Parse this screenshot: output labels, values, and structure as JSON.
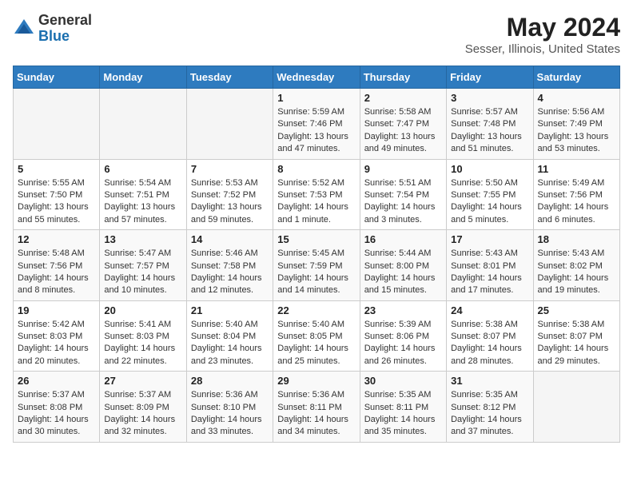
{
  "header": {
    "logo_general": "General",
    "logo_blue": "Blue",
    "title": "May 2024",
    "subtitle": "Sesser, Illinois, United States"
  },
  "calendar": {
    "days_of_week": [
      "Sunday",
      "Monday",
      "Tuesday",
      "Wednesday",
      "Thursday",
      "Friday",
      "Saturday"
    ],
    "weeks": [
      [
        {
          "day": "",
          "info": ""
        },
        {
          "day": "",
          "info": ""
        },
        {
          "day": "",
          "info": ""
        },
        {
          "day": "1",
          "info": "Sunrise: 5:59 AM\nSunset: 7:46 PM\nDaylight: 13 hours\nand 47 minutes."
        },
        {
          "day": "2",
          "info": "Sunrise: 5:58 AM\nSunset: 7:47 PM\nDaylight: 13 hours\nand 49 minutes."
        },
        {
          "day": "3",
          "info": "Sunrise: 5:57 AM\nSunset: 7:48 PM\nDaylight: 13 hours\nand 51 minutes."
        },
        {
          "day": "4",
          "info": "Sunrise: 5:56 AM\nSunset: 7:49 PM\nDaylight: 13 hours\nand 53 minutes."
        }
      ],
      [
        {
          "day": "5",
          "info": "Sunrise: 5:55 AM\nSunset: 7:50 PM\nDaylight: 13 hours\nand 55 minutes."
        },
        {
          "day": "6",
          "info": "Sunrise: 5:54 AM\nSunset: 7:51 PM\nDaylight: 13 hours\nand 57 minutes."
        },
        {
          "day": "7",
          "info": "Sunrise: 5:53 AM\nSunset: 7:52 PM\nDaylight: 13 hours\nand 59 minutes."
        },
        {
          "day": "8",
          "info": "Sunrise: 5:52 AM\nSunset: 7:53 PM\nDaylight: 14 hours\nand 1 minute."
        },
        {
          "day": "9",
          "info": "Sunrise: 5:51 AM\nSunset: 7:54 PM\nDaylight: 14 hours\nand 3 minutes."
        },
        {
          "day": "10",
          "info": "Sunrise: 5:50 AM\nSunset: 7:55 PM\nDaylight: 14 hours\nand 5 minutes."
        },
        {
          "day": "11",
          "info": "Sunrise: 5:49 AM\nSunset: 7:56 PM\nDaylight: 14 hours\nand 6 minutes."
        }
      ],
      [
        {
          "day": "12",
          "info": "Sunrise: 5:48 AM\nSunset: 7:56 PM\nDaylight: 14 hours\nand 8 minutes."
        },
        {
          "day": "13",
          "info": "Sunrise: 5:47 AM\nSunset: 7:57 PM\nDaylight: 14 hours\nand 10 minutes."
        },
        {
          "day": "14",
          "info": "Sunrise: 5:46 AM\nSunset: 7:58 PM\nDaylight: 14 hours\nand 12 minutes."
        },
        {
          "day": "15",
          "info": "Sunrise: 5:45 AM\nSunset: 7:59 PM\nDaylight: 14 hours\nand 14 minutes."
        },
        {
          "day": "16",
          "info": "Sunrise: 5:44 AM\nSunset: 8:00 PM\nDaylight: 14 hours\nand 15 minutes."
        },
        {
          "day": "17",
          "info": "Sunrise: 5:43 AM\nSunset: 8:01 PM\nDaylight: 14 hours\nand 17 minutes."
        },
        {
          "day": "18",
          "info": "Sunrise: 5:43 AM\nSunset: 8:02 PM\nDaylight: 14 hours\nand 19 minutes."
        }
      ],
      [
        {
          "day": "19",
          "info": "Sunrise: 5:42 AM\nSunset: 8:03 PM\nDaylight: 14 hours\nand 20 minutes."
        },
        {
          "day": "20",
          "info": "Sunrise: 5:41 AM\nSunset: 8:03 PM\nDaylight: 14 hours\nand 22 minutes."
        },
        {
          "day": "21",
          "info": "Sunrise: 5:40 AM\nSunset: 8:04 PM\nDaylight: 14 hours\nand 23 minutes."
        },
        {
          "day": "22",
          "info": "Sunrise: 5:40 AM\nSunset: 8:05 PM\nDaylight: 14 hours\nand 25 minutes."
        },
        {
          "day": "23",
          "info": "Sunrise: 5:39 AM\nSunset: 8:06 PM\nDaylight: 14 hours\nand 26 minutes."
        },
        {
          "day": "24",
          "info": "Sunrise: 5:38 AM\nSunset: 8:07 PM\nDaylight: 14 hours\nand 28 minutes."
        },
        {
          "day": "25",
          "info": "Sunrise: 5:38 AM\nSunset: 8:07 PM\nDaylight: 14 hours\nand 29 minutes."
        }
      ],
      [
        {
          "day": "26",
          "info": "Sunrise: 5:37 AM\nSunset: 8:08 PM\nDaylight: 14 hours\nand 30 minutes."
        },
        {
          "day": "27",
          "info": "Sunrise: 5:37 AM\nSunset: 8:09 PM\nDaylight: 14 hours\nand 32 minutes."
        },
        {
          "day": "28",
          "info": "Sunrise: 5:36 AM\nSunset: 8:10 PM\nDaylight: 14 hours\nand 33 minutes."
        },
        {
          "day": "29",
          "info": "Sunrise: 5:36 AM\nSunset: 8:11 PM\nDaylight: 14 hours\nand 34 minutes."
        },
        {
          "day": "30",
          "info": "Sunrise: 5:35 AM\nSunset: 8:11 PM\nDaylight: 14 hours\nand 35 minutes."
        },
        {
          "day": "31",
          "info": "Sunrise: 5:35 AM\nSunset: 8:12 PM\nDaylight: 14 hours\nand 37 minutes."
        },
        {
          "day": "",
          "info": ""
        }
      ]
    ]
  }
}
